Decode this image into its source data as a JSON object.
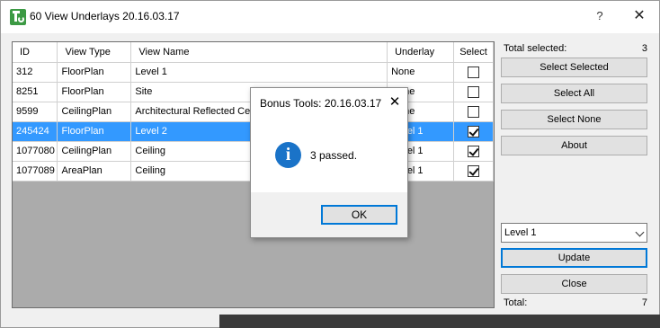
{
  "window": {
    "title": "60 View Underlays 20.16.03.17",
    "help": "?",
    "close": "✕"
  },
  "grid": {
    "columns": [
      "ID",
      "View Type",
      "View Name",
      "Underlay",
      "Select"
    ],
    "rows": [
      {
        "id": "312",
        "view_type": "FloorPlan",
        "view_name": "Level 1",
        "underlay": "None",
        "selected": false,
        "highlighted": false
      },
      {
        "id": "8251",
        "view_type": "FloorPlan",
        "view_name": "Site",
        "underlay": "None",
        "selected": false,
        "highlighted": false
      },
      {
        "id": "9599",
        "view_type": "CeilingPlan",
        "view_name": "Architectural Reflected Ceiling Plan",
        "underlay": "None",
        "selected": false,
        "highlighted": false
      },
      {
        "id": "245424",
        "view_type": "FloorPlan",
        "view_name": "Level 2",
        "underlay": "Level 1",
        "selected": true,
        "highlighted": true
      },
      {
        "id": "1077080",
        "view_type": "CeilingPlan",
        "view_name": "Ceiling",
        "underlay": "Level 1",
        "selected": true,
        "highlighted": false
      },
      {
        "id": "1077089",
        "view_type": "AreaPlan",
        "view_name": "Ceiling",
        "underlay": "Level 1",
        "selected": true,
        "highlighted": false
      }
    ]
  },
  "panel": {
    "total_selected_label": "Total selected:",
    "total_selected_value": "3",
    "buttons": {
      "select_selected": "Select Selected",
      "select_all": "Select All",
      "select_none": "Select None",
      "about": "About",
      "update": "Update",
      "close": "Close"
    },
    "level_dropdown": "Level 1",
    "total_label": "Total:",
    "total_value": "7"
  },
  "dialog": {
    "title": "Bonus Tools: 20.16.03.17",
    "close": "✕",
    "icon": "information-icon",
    "message": "3 passed.",
    "ok_label": "OK"
  },
  "colors": {
    "selection": "#3399ff",
    "accent_border": "#0078d7",
    "info_icon": "#1a73c8"
  }
}
